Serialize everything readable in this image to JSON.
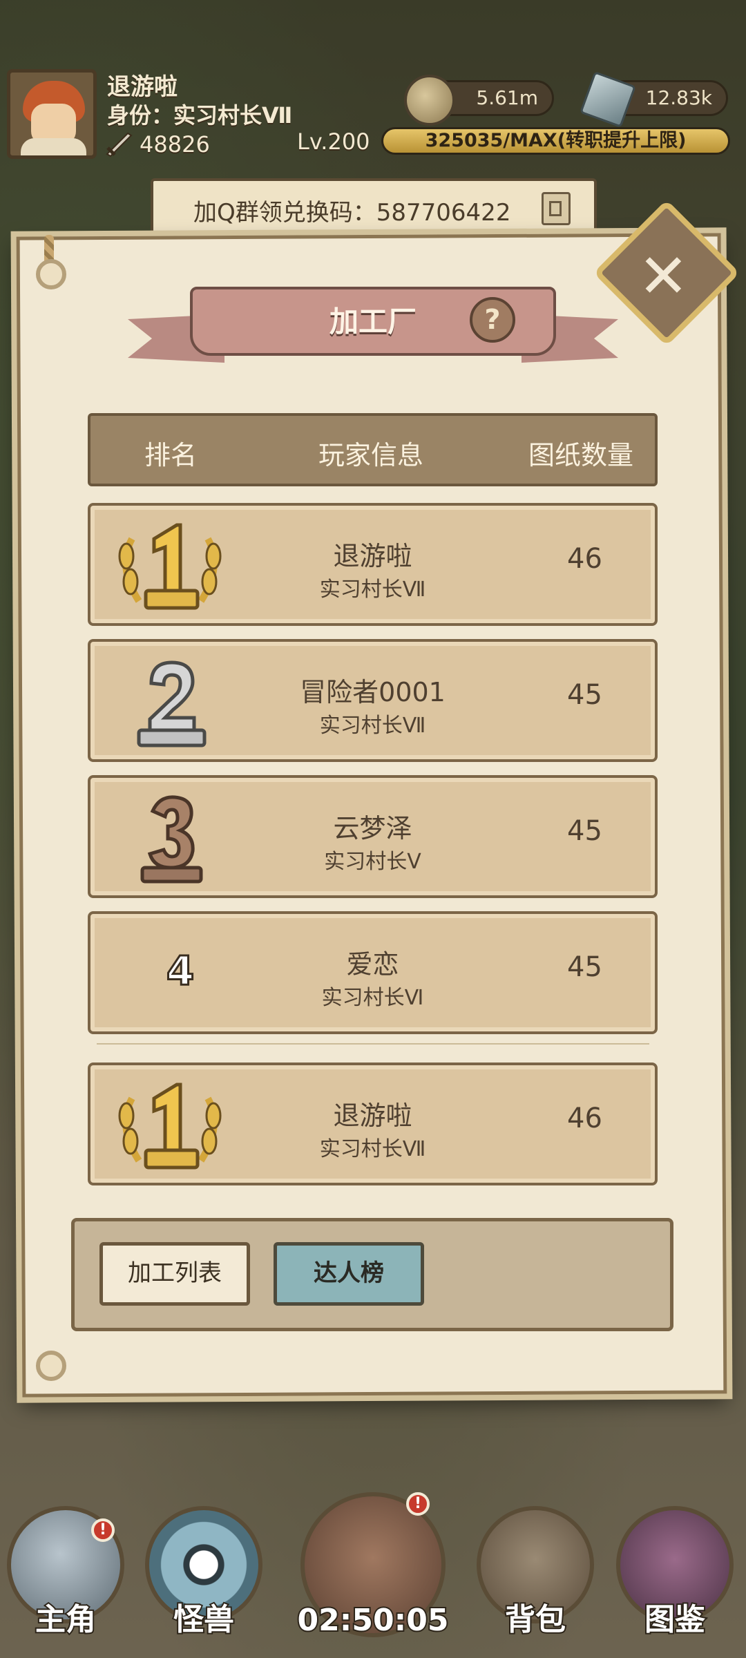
{
  "player": {
    "name": "退游啦",
    "role": "身份：实习村长Ⅶ",
    "power": "48826",
    "level": "Lv.200"
  },
  "currencies": {
    "coins": "5.61m",
    "gems": "12.83k"
  },
  "xp": {
    "text": "325035/MAX(转职提升上限)",
    "progress": 1.0
  },
  "group": {
    "text": "加Q群领兑换码：587706422"
  },
  "panel": {
    "title": "加工厂",
    "help": "?",
    "close": "✕",
    "columns": [
      "排名",
      "玩家信息",
      "图纸数量"
    ],
    "rows": [
      {
        "rank": "1",
        "name": "退游啦",
        "title": "实习村长Ⅶ",
        "count": "46"
      },
      {
        "rank": "2",
        "name": "冒险者0001",
        "title": "实习村长Ⅶ",
        "count": "45"
      },
      {
        "rank": "3",
        "name": "云梦泽",
        "title": "实习村长Ⅴ",
        "count": "45"
      },
      {
        "rank": "4",
        "name": "爱恋",
        "title": "实习村长Ⅵ",
        "count": "45"
      }
    ],
    "self_row": {
      "rank": "1",
      "name": "退游啦",
      "title": "实习村长Ⅶ",
      "count": "46"
    },
    "tabs": [
      "加工列表",
      "达人榜"
    ],
    "active_tab": "达人榜"
  },
  "nav": {
    "items": [
      "主角",
      "怪兽",
      "背包",
      "图鉴"
    ],
    "timer": "02:50:05"
  },
  "colors": {
    "gold": "#e2b84a",
    "silver": "#c9c9c9",
    "bronze": "#a07a62",
    "active_tab": "#8cb4b8"
  }
}
